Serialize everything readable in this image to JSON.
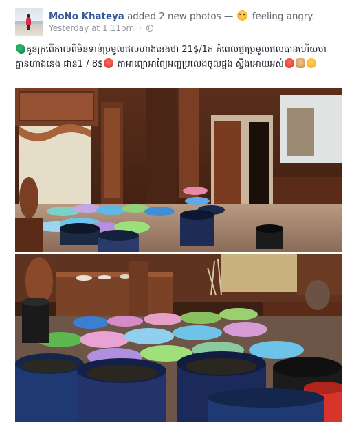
{
  "post": {
    "author": "MoNo Khateya",
    "action": " added 2 new photos — ",
    "feeling": "feeling angry.",
    "timestamp": "Yesterday at 1:11pm",
    "meta_separator": "·",
    "privacy_icon": "globe-icon",
    "feeling_icon": "angry-face-icon",
    "caption_part1": "គូនក្រពើកាលពីមិនទាន់ប្រមូលផលហាងនេងថា 21$/1ក គំពេលផ្ទាប្រមូលផលបានហើយចាគ្នានហាងនេង ជាន1 / 8$",
    "caption_part2": " គាអាព្យោអាព្យែអញ្ជប្រលេងចូលផ្គង ស្ទឹងអោយអស់",
    "caption_icons": [
      "leaf-emoji-icon",
      "angry-red-emoji-icon",
      "fist-emoji-icon",
      "laughing-emoji-icon"
    ],
    "photos": [
      {
        "name": "photo-room-basins-1"
      },
      {
        "name": "photo-room-basins-2"
      }
    ]
  },
  "colors": {
    "author_link": "#365899",
    "secondary_text": "#90949c",
    "body_text": "#1d2129"
  }
}
